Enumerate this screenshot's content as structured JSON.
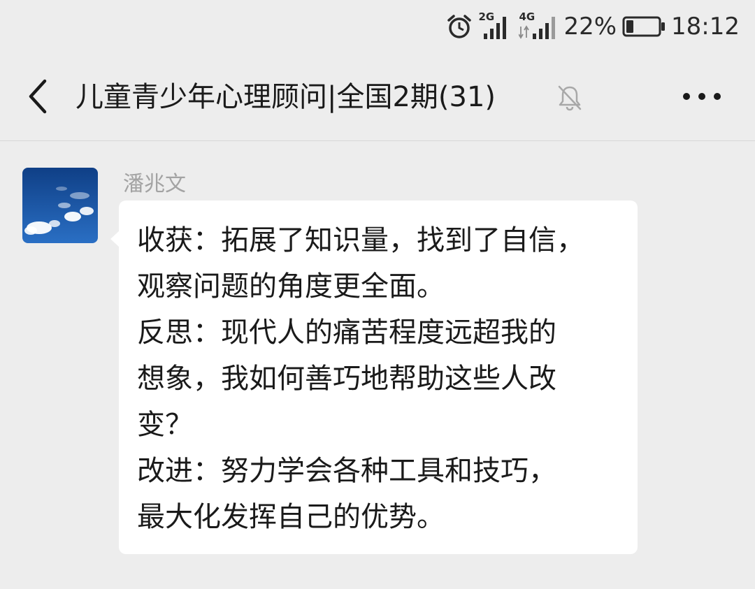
{
  "status_bar": {
    "alarm_icon": "alarm-clock-icon",
    "signal_2g_label": "2G",
    "signal_4g_label": "4G",
    "battery_percent": "22%",
    "battery_level": 0.22,
    "time": "18:12"
  },
  "header": {
    "back_icon": "chevron-left-icon",
    "title": "儿童青少年心理顾问|全国2期(31)",
    "mute_icon": "bell-muted-icon",
    "more_icon": "more-dots-icon"
  },
  "message": {
    "sender": "潘兆文",
    "avatar_icon": "sky-clouds-avatar",
    "lines": [
      "收获：拓展了知识量，找到了自信，",
      "观察问题的角度更全面。",
      "反思：现代人的痛苦程度远超我的",
      "想象，我如何善巧地帮助这些人改",
      "变？",
      "改进：努力学会各种工具和技巧，",
      "最大化发挥自己的优势。"
    ]
  },
  "colors": {
    "background": "#ededed",
    "bubble": "#ffffff",
    "sender_name": "#a3a3a3",
    "text": "#1a1a1a"
  }
}
